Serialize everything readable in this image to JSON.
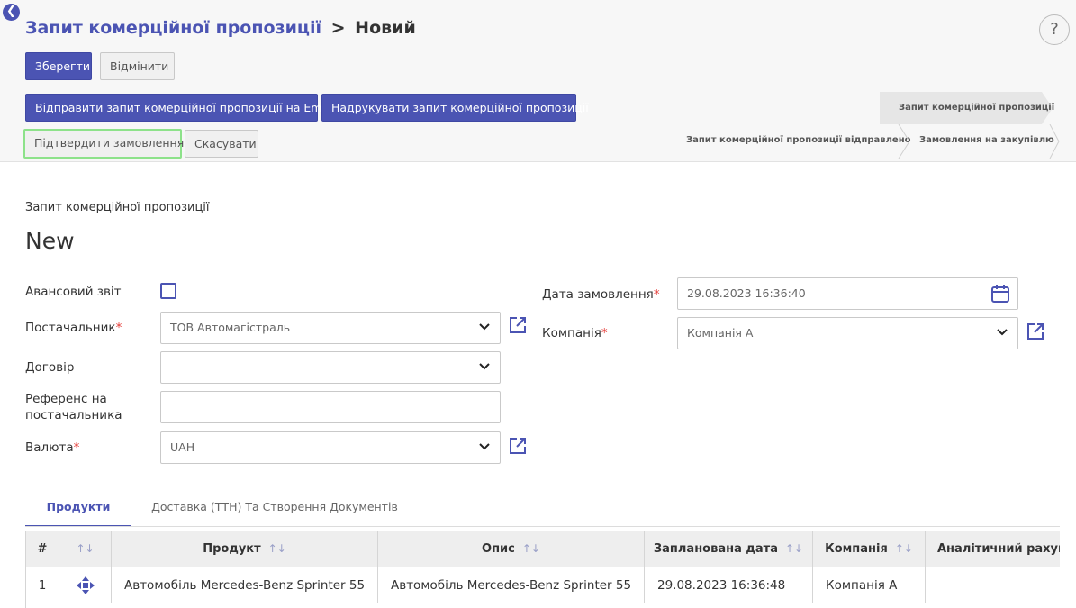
{
  "breadcrumb": {
    "parent": "Запит комерційної пропозиції",
    "separator": ">",
    "current": "Новий"
  },
  "help_label": "?",
  "toolbar": {
    "save_label": "Зберегти",
    "discard_label": "Відмінити"
  },
  "actions": {
    "send_email": "Відправити запит комерційної пропозиції на Email",
    "print": "Надрукувати запит комерційної пропозиції",
    "confirm": "Підтвердити замовлення",
    "cancel": "Скасувати"
  },
  "statusbar": {
    "steps": [
      {
        "label": "Запит комерційної пропозиції",
        "active": true
      },
      {
        "label": "Запит комерційної пропозиції відправлено",
        "active": false
      },
      {
        "label": "Замовлення на закупівлю",
        "active": false
      }
    ]
  },
  "form": {
    "subtitle": "Запит комерційної пропозиції",
    "name": "New",
    "fields": {
      "advance_report": {
        "label": "Авансовий звіт",
        "checked": false
      },
      "vendor": {
        "label": "Постачальник",
        "value": "ТОВ Автомагістраль",
        "required": true
      },
      "contract": {
        "label": "Договір",
        "value": ""
      },
      "vendor_ref": {
        "label_line1": "Референс на",
        "label_line2": "постачальника",
        "value": ""
      },
      "currency": {
        "label": "Валюта",
        "value": "UAH",
        "required": true
      },
      "order_date": {
        "label": "Дата замовлення",
        "value": "29.08.2023 16:36:40",
        "required": true
      },
      "company": {
        "label": "Компанія",
        "value": "Компанія A",
        "required": true
      }
    },
    "required_mark": "*"
  },
  "tabs": [
    {
      "label": "Продукти",
      "active": true
    },
    {
      "label": "Доставка (ТТН) Та Створення Документів",
      "active": false
    }
  ],
  "table": {
    "headers": [
      "#",
      "",
      "Продукт",
      "Опис",
      "Запланована дата",
      "Компанія",
      "Аналітичний рахунок"
    ],
    "rows": [
      [
        "1",
        "",
        "Автомобіль Mercedes-Benz Sprinter 55",
        "Автомобіль Mercedes-Benz Sprinter 55",
        "29.08.2023 16:36:48",
        "Компанія A",
        ""
      ]
    ]
  },
  "colors": {
    "primary": "#4b54b3",
    "confirm_outline": "#8de28a",
    "required": "#e53935"
  }
}
